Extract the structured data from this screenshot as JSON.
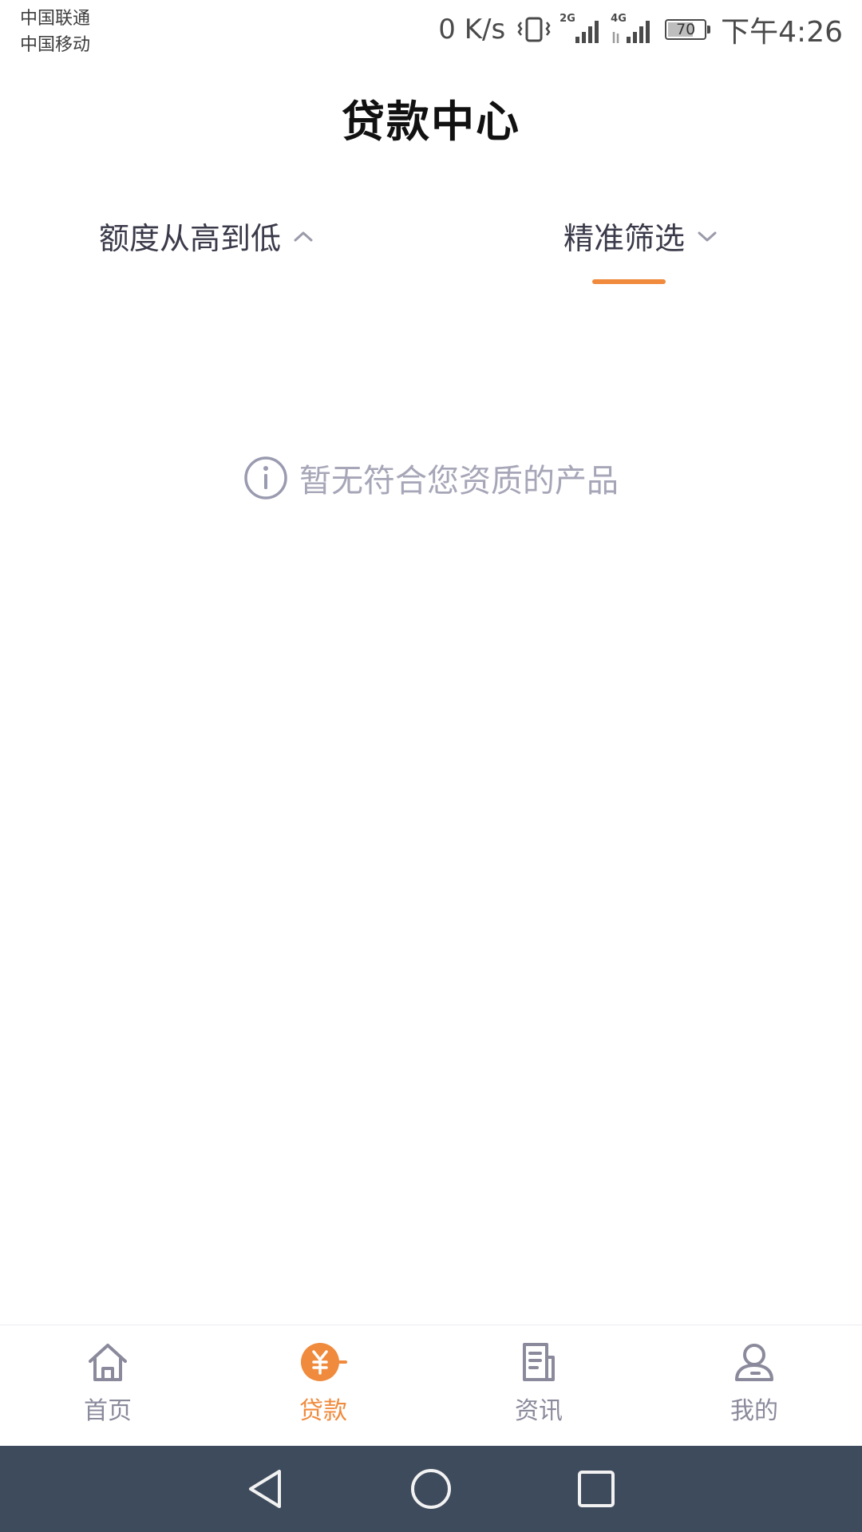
{
  "status_bar": {
    "carrier_1": "中国联通",
    "carrier_2": "中国移动",
    "net_speed": "0 K/s",
    "signal_1_type": "2G",
    "signal_2_type": "4G",
    "battery_level": "70",
    "time": "下午4:26",
    "icons": [
      "vibrate-icon",
      "signal-2g-icon",
      "signal-4g-icon",
      "battery-icon"
    ]
  },
  "header": {
    "title": "贷款中心"
  },
  "filters": {
    "sort_label": "额度从高到低",
    "sort_icon": "chevron-up-icon",
    "precise_label": "精准筛选",
    "precise_icon": "chevron-down-icon",
    "active": "精准筛选"
  },
  "empty_state": {
    "icon": "info-icon",
    "message": "暂无符合您资质的产品"
  },
  "tab_bar": {
    "active": "贷款",
    "tabs": [
      {
        "label": "首页",
        "icon": "home-icon"
      },
      {
        "label": "贷款",
        "icon": "yen-icon"
      },
      {
        "label": "资讯",
        "icon": "news-icon"
      },
      {
        "label": "我的",
        "icon": "user-icon"
      }
    ]
  },
  "colors": {
    "accent": "#f08a3c",
    "tab_inactive": "#8a8a9c",
    "empty_text": "#a6a6b8",
    "nav_bar_bg": "#3e4b5c"
  }
}
